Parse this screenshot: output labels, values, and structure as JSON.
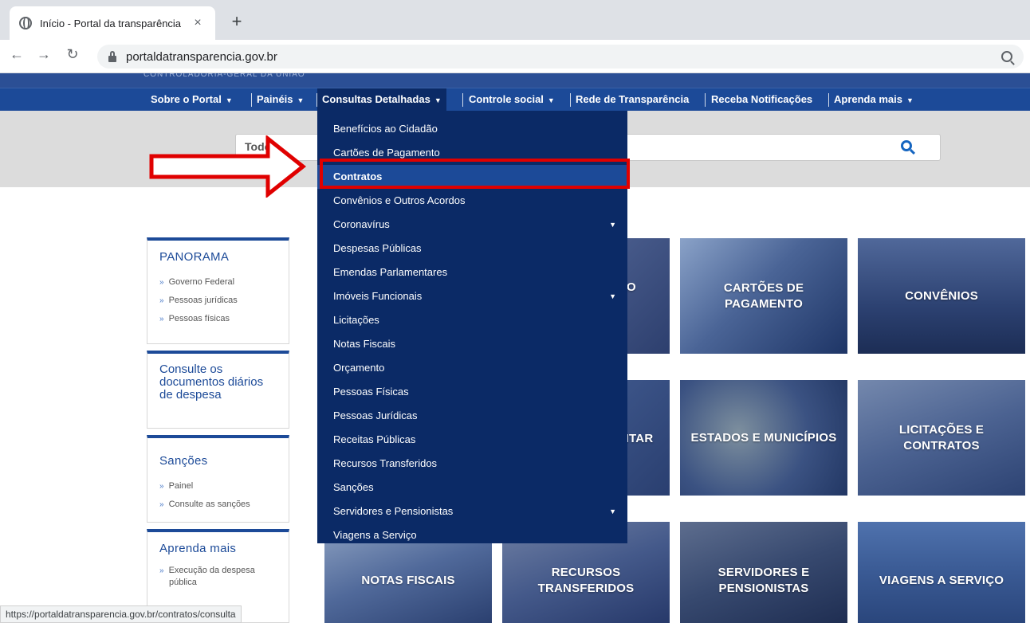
{
  "browser": {
    "tab_title": "Início - Portal da transparência",
    "tab_close": "×",
    "new_tab": "+",
    "url": "portaldatransparencia.gov.br",
    "status_url": "https://portaldatransparencia.gov.br/contratos/consulta"
  },
  "header": {
    "agency": "CONTROLADORIA-GERAL DA UNIÃO"
  },
  "nav": {
    "items": [
      {
        "label": "Sobre o Portal",
        "caret": "▼"
      },
      {
        "label": "Painéis",
        "caret": "▼"
      },
      {
        "label": "Consultas Detalhadas",
        "caret": "▼"
      },
      {
        "label": "Controle social",
        "caret": "▼"
      },
      {
        "label": "Rede de Transparência"
      },
      {
        "label": "Receba Notificações"
      },
      {
        "label": "Aprenda mais",
        "caret": "▼"
      }
    ]
  },
  "search": {
    "label": "Todo"
  },
  "dropdown": {
    "items": [
      {
        "label": "Benefícios ao Cidadão"
      },
      {
        "label": "Cartões de Pagamento"
      },
      {
        "label": "Contratos"
      },
      {
        "label": "Convênios e Outros Acordos"
      },
      {
        "label": "Coronavírus",
        "caret": "▼"
      },
      {
        "label": "Despesas Públicas"
      },
      {
        "label": "Emendas Parlamentares"
      },
      {
        "label": "Imóveis Funcionais",
        "caret": "▼"
      },
      {
        "label": "Licitações"
      },
      {
        "label": "Notas Fiscais"
      },
      {
        "label": "Orçamento"
      },
      {
        "label": "Pessoas Físicas"
      },
      {
        "label": "Pessoas Jurídicas"
      },
      {
        "label": "Receitas Públicas"
      },
      {
        "label": "Recursos Transferidos"
      },
      {
        "label": "Sanções"
      },
      {
        "label": "Servidores e Pensionistas",
        "caret": "▼"
      },
      {
        "label": "Viagens a Serviço"
      }
    ]
  },
  "sidebar": {
    "panorama": {
      "title": "PANORAMA",
      "links": [
        "Governo Federal",
        "Pessoas jurídicas",
        "Pessoas físicas"
      ]
    },
    "documentos": {
      "title": "Consulte os documentos diários de despesa"
    },
    "sancoes": {
      "title": "Sanções",
      "links": [
        "Painel",
        "Consulte as sanções"
      ]
    },
    "aprenda": {
      "title": "Aprenda mais",
      "links": [
        "Execução da despesa pública"
      ]
    },
    "bullet": "»"
  },
  "tiles": {
    "partial_o": "O",
    "cartoes": "CARTÕES DE PAGAMENTO",
    "convenios": "CONVÊNIOS",
    "partial_entar": "NTAR",
    "estados": "ESTADOS E MUNICÍPIOS",
    "licitacoes": "LICITAÇÕES E CONTRATOS",
    "notas": "NOTAS FISCAIS",
    "recursos": "RECURSOS TRANSFERIDOS",
    "servidores": "SERVIDORES E PENSIONISTAS",
    "viagens": "VIAGENS A SERVIÇO"
  },
  "colors": {
    "nav_blue": "#1c4a98",
    "dropdown_navy": "#0b2a66",
    "annotation_red": "#e00000"
  }
}
